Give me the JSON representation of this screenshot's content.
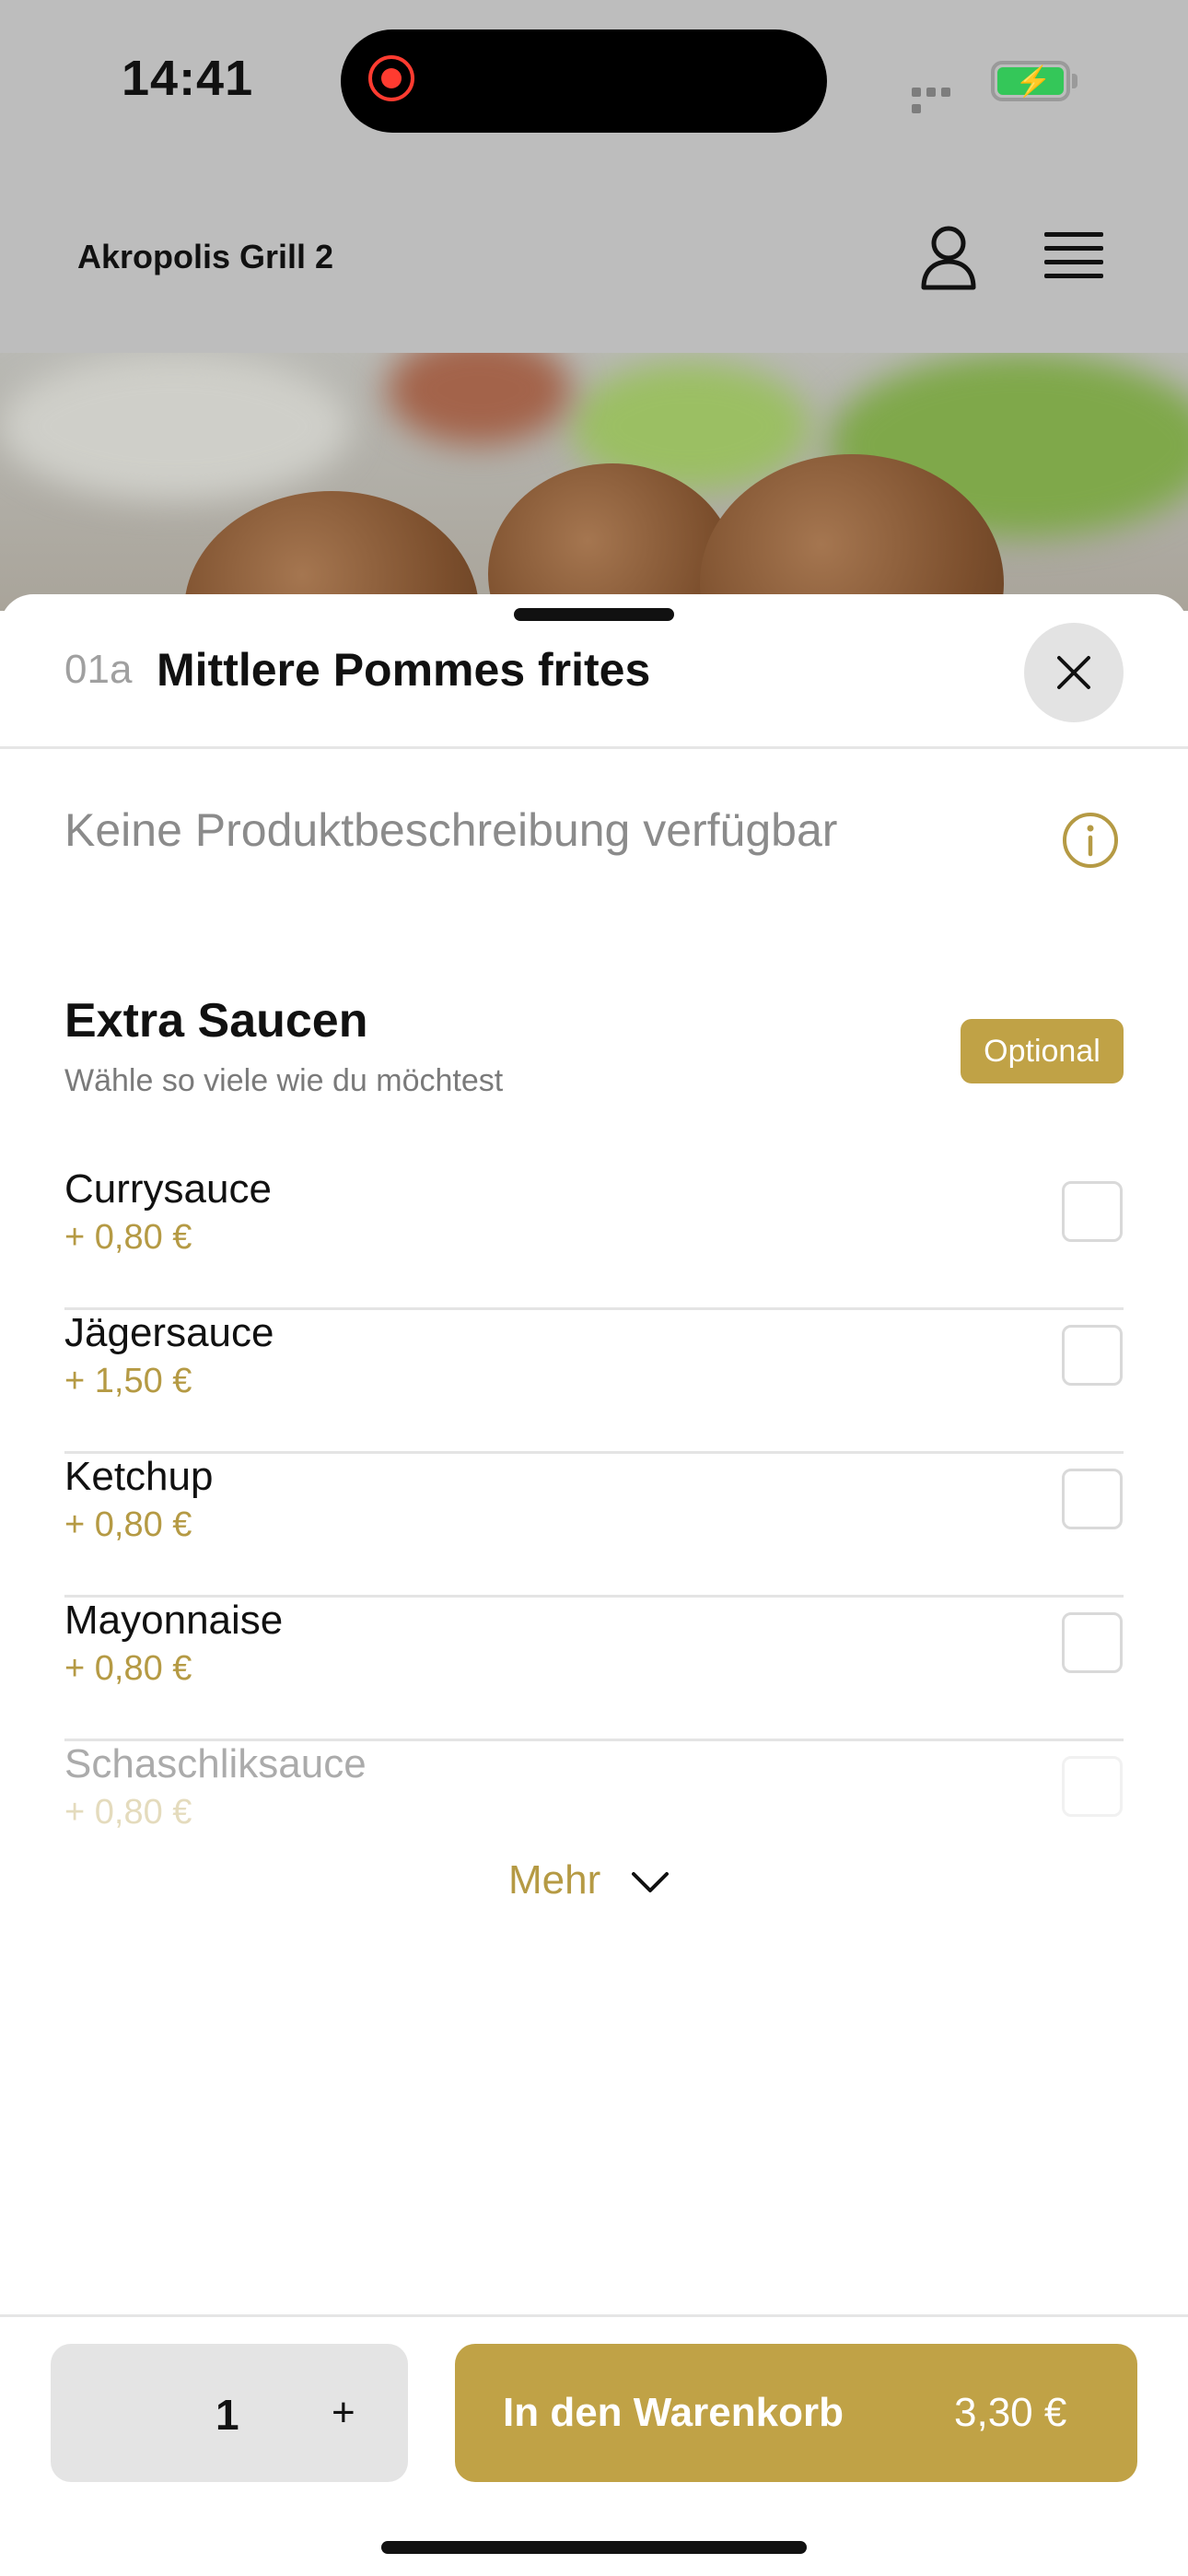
{
  "status_bar": {
    "time": "14:41"
  },
  "header": {
    "restaurant_name": "Akropolis Grill 2"
  },
  "product": {
    "number": "01a",
    "title": "Mittlere Pommes frites",
    "description": "Keine Produktbeschreibung verfügbar"
  },
  "option_group": {
    "title": "Extra Saucen",
    "subtitle": "Wähle so viele wie du möchtest",
    "badge": "Optional",
    "items": [
      {
        "name": "Currysauce",
        "price": "+ 0,80 €"
      },
      {
        "name": "Jägersauce",
        "price": "+ 1,50 €"
      },
      {
        "name": "Ketchup",
        "price": "+ 0,80 €"
      },
      {
        "name": "Mayonnaise",
        "price": "+ 0,80 €"
      },
      {
        "name": "Schaschliksauce",
        "price": "+ 0,80 €"
      }
    ],
    "more_label": "Mehr"
  },
  "footer": {
    "quantity": "1",
    "plus_label": "+",
    "cart_label": "In den Warenkorb",
    "cart_price": "3,30 €"
  },
  "colors": {
    "accent": "#c0a246",
    "price": "#b59a44"
  },
  "icons": [
    "user-icon",
    "menu-icon",
    "close-icon",
    "info-icon",
    "chevron-down-icon"
  ]
}
